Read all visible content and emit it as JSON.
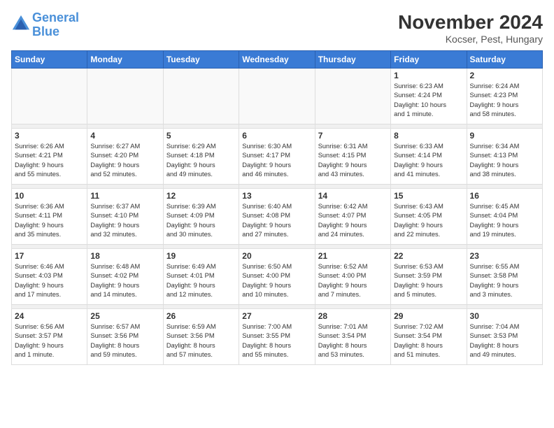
{
  "header": {
    "logo_line1": "General",
    "logo_line2": "Blue",
    "month": "November 2024",
    "location": "Kocser, Pest, Hungary"
  },
  "weekdays": [
    "Sunday",
    "Monday",
    "Tuesday",
    "Wednesday",
    "Thursday",
    "Friday",
    "Saturday"
  ],
  "weeks": [
    {
      "days": [
        {
          "num": "",
          "info": ""
        },
        {
          "num": "",
          "info": ""
        },
        {
          "num": "",
          "info": ""
        },
        {
          "num": "",
          "info": ""
        },
        {
          "num": "",
          "info": ""
        },
        {
          "num": "1",
          "info": "Sunrise: 6:23 AM\nSunset: 4:24 PM\nDaylight: 10 hours\nand 1 minute."
        },
        {
          "num": "2",
          "info": "Sunrise: 6:24 AM\nSunset: 4:23 PM\nDaylight: 9 hours\nand 58 minutes."
        }
      ]
    },
    {
      "days": [
        {
          "num": "3",
          "info": "Sunrise: 6:26 AM\nSunset: 4:21 PM\nDaylight: 9 hours\nand 55 minutes."
        },
        {
          "num": "4",
          "info": "Sunrise: 6:27 AM\nSunset: 4:20 PM\nDaylight: 9 hours\nand 52 minutes."
        },
        {
          "num": "5",
          "info": "Sunrise: 6:29 AM\nSunset: 4:18 PM\nDaylight: 9 hours\nand 49 minutes."
        },
        {
          "num": "6",
          "info": "Sunrise: 6:30 AM\nSunset: 4:17 PM\nDaylight: 9 hours\nand 46 minutes."
        },
        {
          "num": "7",
          "info": "Sunrise: 6:31 AM\nSunset: 4:15 PM\nDaylight: 9 hours\nand 43 minutes."
        },
        {
          "num": "8",
          "info": "Sunrise: 6:33 AM\nSunset: 4:14 PM\nDaylight: 9 hours\nand 41 minutes."
        },
        {
          "num": "9",
          "info": "Sunrise: 6:34 AM\nSunset: 4:13 PM\nDaylight: 9 hours\nand 38 minutes."
        }
      ]
    },
    {
      "days": [
        {
          "num": "10",
          "info": "Sunrise: 6:36 AM\nSunset: 4:11 PM\nDaylight: 9 hours\nand 35 minutes."
        },
        {
          "num": "11",
          "info": "Sunrise: 6:37 AM\nSunset: 4:10 PM\nDaylight: 9 hours\nand 32 minutes."
        },
        {
          "num": "12",
          "info": "Sunrise: 6:39 AM\nSunset: 4:09 PM\nDaylight: 9 hours\nand 30 minutes."
        },
        {
          "num": "13",
          "info": "Sunrise: 6:40 AM\nSunset: 4:08 PM\nDaylight: 9 hours\nand 27 minutes."
        },
        {
          "num": "14",
          "info": "Sunrise: 6:42 AM\nSunset: 4:07 PM\nDaylight: 9 hours\nand 24 minutes."
        },
        {
          "num": "15",
          "info": "Sunrise: 6:43 AM\nSunset: 4:05 PM\nDaylight: 9 hours\nand 22 minutes."
        },
        {
          "num": "16",
          "info": "Sunrise: 6:45 AM\nSunset: 4:04 PM\nDaylight: 9 hours\nand 19 minutes."
        }
      ]
    },
    {
      "days": [
        {
          "num": "17",
          "info": "Sunrise: 6:46 AM\nSunset: 4:03 PM\nDaylight: 9 hours\nand 17 minutes."
        },
        {
          "num": "18",
          "info": "Sunrise: 6:48 AM\nSunset: 4:02 PM\nDaylight: 9 hours\nand 14 minutes."
        },
        {
          "num": "19",
          "info": "Sunrise: 6:49 AM\nSunset: 4:01 PM\nDaylight: 9 hours\nand 12 minutes."
        },
        {
          "num": "20",
          "info": "Sunrise: 6:50 AM\nSunset: 4:00 PM\nDaylight: 9 hours\nand 10 minutes."
        },
        {
          "num": "21",
          "info": "Sunrise: 6:52 AM\nSunset: 4:00 PM\nDaylight: 9 hours\nand 7 minutes."
        },
        {
          "num": "22",
          "info": "Sunrise: 6:53 AM\nSunset: 3:59 PM\nDaylight: 9 hours\nand 5 minutes."
        },
        {
          "num": "23",
          "info": "Sunrise: 6:55 AM\nSunset: 3:58 PM\nDaylight: 9 hours\nand 3 minutes."
        }
      ]
    },
    {
      "days": [
        {
          "num": "24",
          "info": "Sunrise: 6:56 AM\nSunset: 3:57 PM\nDaylight: 9 hours\nand 1 minute."
        },
        {
          "num": "25",
          "info": "Sunrise: 6:57 AM\nSunset: 3:56 PM\nDaylight: 8 hours\nand 59 minutes."
        },
        {
          "num": "26",
          "info": "Sunrise: 6:59 AM\nSunset: 3:56 PM\nDaylight: 8 hours\nand 57 minutes."
        },
        {
          "num": "27",
          "info": "Sunrise: 7:00 AM\nSunset: 3:55 PM\nDaylight: 8 hours\nand 55 minutes."
        },
        {
          "num": "28",
          "info": "Sunrise: 7:01 AM\nSunset: 3:54 PM\nDaylight: 8 hours\nand 53 minutes."
        },
        {
          "num": "29",
          "info": "Sunrise: 7:02 AM\nSunset: 3:54 PM\nDaylight: 8 hours\nand 51 minutes."
        },
        {
          "num": "30",
          "info": "Sunrise: 7:04 AM\nSunset: 3:53 PM\nDaylight: 8 hours\nand 49 minutes."
        }
      ]
    }
  ]
}
